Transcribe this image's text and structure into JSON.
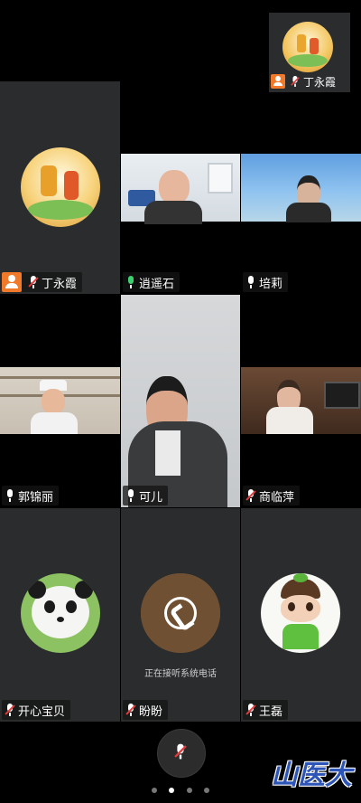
{
  "self_view": {
    "name": "丁永霞"
  },
  "tiles": [
    {
      "id": "t1",
      "name": "丁永霞",
      "mic": "muted",
      "host": true
    },
    {
      "id": "t2",
      "name": "逍遥石",
      "mic": "on",
      "host": false
    },
    {
      "id": "t3",
      "name": "培莉",
      "mic": "normal",
      "host": false
    },
    {
      "id": "t4",
      "name": "郭锦丽",
      "mic": "normal",
      "host": false
    },
    {
      "id": "t5",
      "name": "可儿",
      "mic": "normal",
      "host": false
    },
    {
      "id": "t6",
      "name": "商临萍",
      "mic": "muted",
      "host": false
    },
    {
      "id": "t7",
      "name": "开心宝贝",
      "mic": "muted",
      "host": false
    },
    {
      "id": "t8",
      "name": "盼盼",
      "mic": "muted",
      "host": false
    },
    {
      "id": "t9",
      "name": "王磊",
      "mic": "muted",
      "host": false
    }
  ],
  "phone_call_status": "正在接听系统电话",
  "watermark": "山医大",
  "pagination": {
    "pages": 4,
    "active": 1
  },
  "colors": {
    "host_badge": "#f07a2a",
    "mic_on": "#3bd16f",
    "muted_slash": "#e23c3c"
  }
}
